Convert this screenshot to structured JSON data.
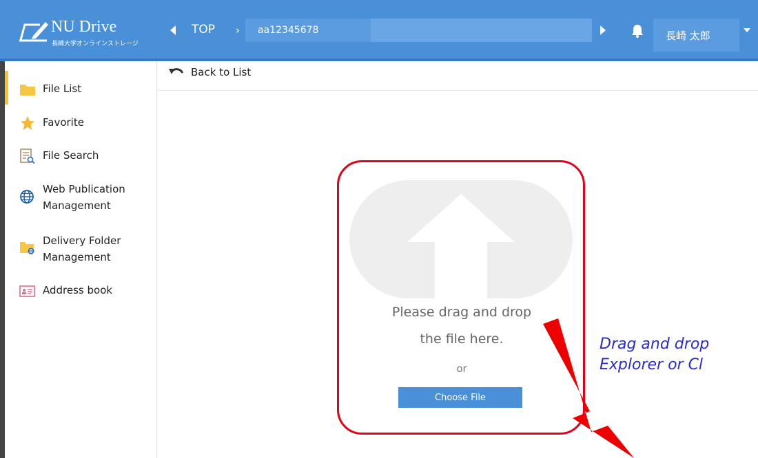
{
  "header": {
    "logo_title": "NU Drive",
    "logo_subtitle": "長崎大学オンラインストレージ",
    "breadcrumb_top": "TOP",
    "breadcrumb_separator": "›",
    "breadcrumb_current": "aa12345678",
    "user_name": "長崎 太郎",
    "accent_color": "#4a90d9"
  },
  "sidebar": {
    "items": [
      {
        "label_lines": [
          "File List"
        ],
        "icon": "folder-icon"
      },
      {
        "label_lines": [
          "Favorite"
        ],
        "icon": "star-icon"
      },
      {
        "label_lines": [
          "File Search"
        ],
        "icon": "file-search-icon"
      },
      {
        "label_lines": [
          "Web Publication",
          "Management"
        ],
        "icon": "globe-icon"
      },
      {
        "label_lines": [
          "Delivery Folder",
          "Management"
        ],
        "icon": "delivery-folder-icon"
      },
      {
        "label_lines": [
          "Address book"
        ],
        "icon": "address-book-icon"
      }
    ],
    "active_index": 0
  },
  "subbar": {
    "back_label": "Back to List"
  },
  "upload": {
    "drop_lines": [
      "Please drag and drop",
      "the file here."
    ],
    "or_text": "or",
    "button_label": "Choose File",
    "highlight_color": "#e3001b"
  },
  "annotation": {
    "lines": [
      "Drag and drop",
      "Explorer or Cl"
    ],
    "text_color": "#2a2ad8"
  }
}
